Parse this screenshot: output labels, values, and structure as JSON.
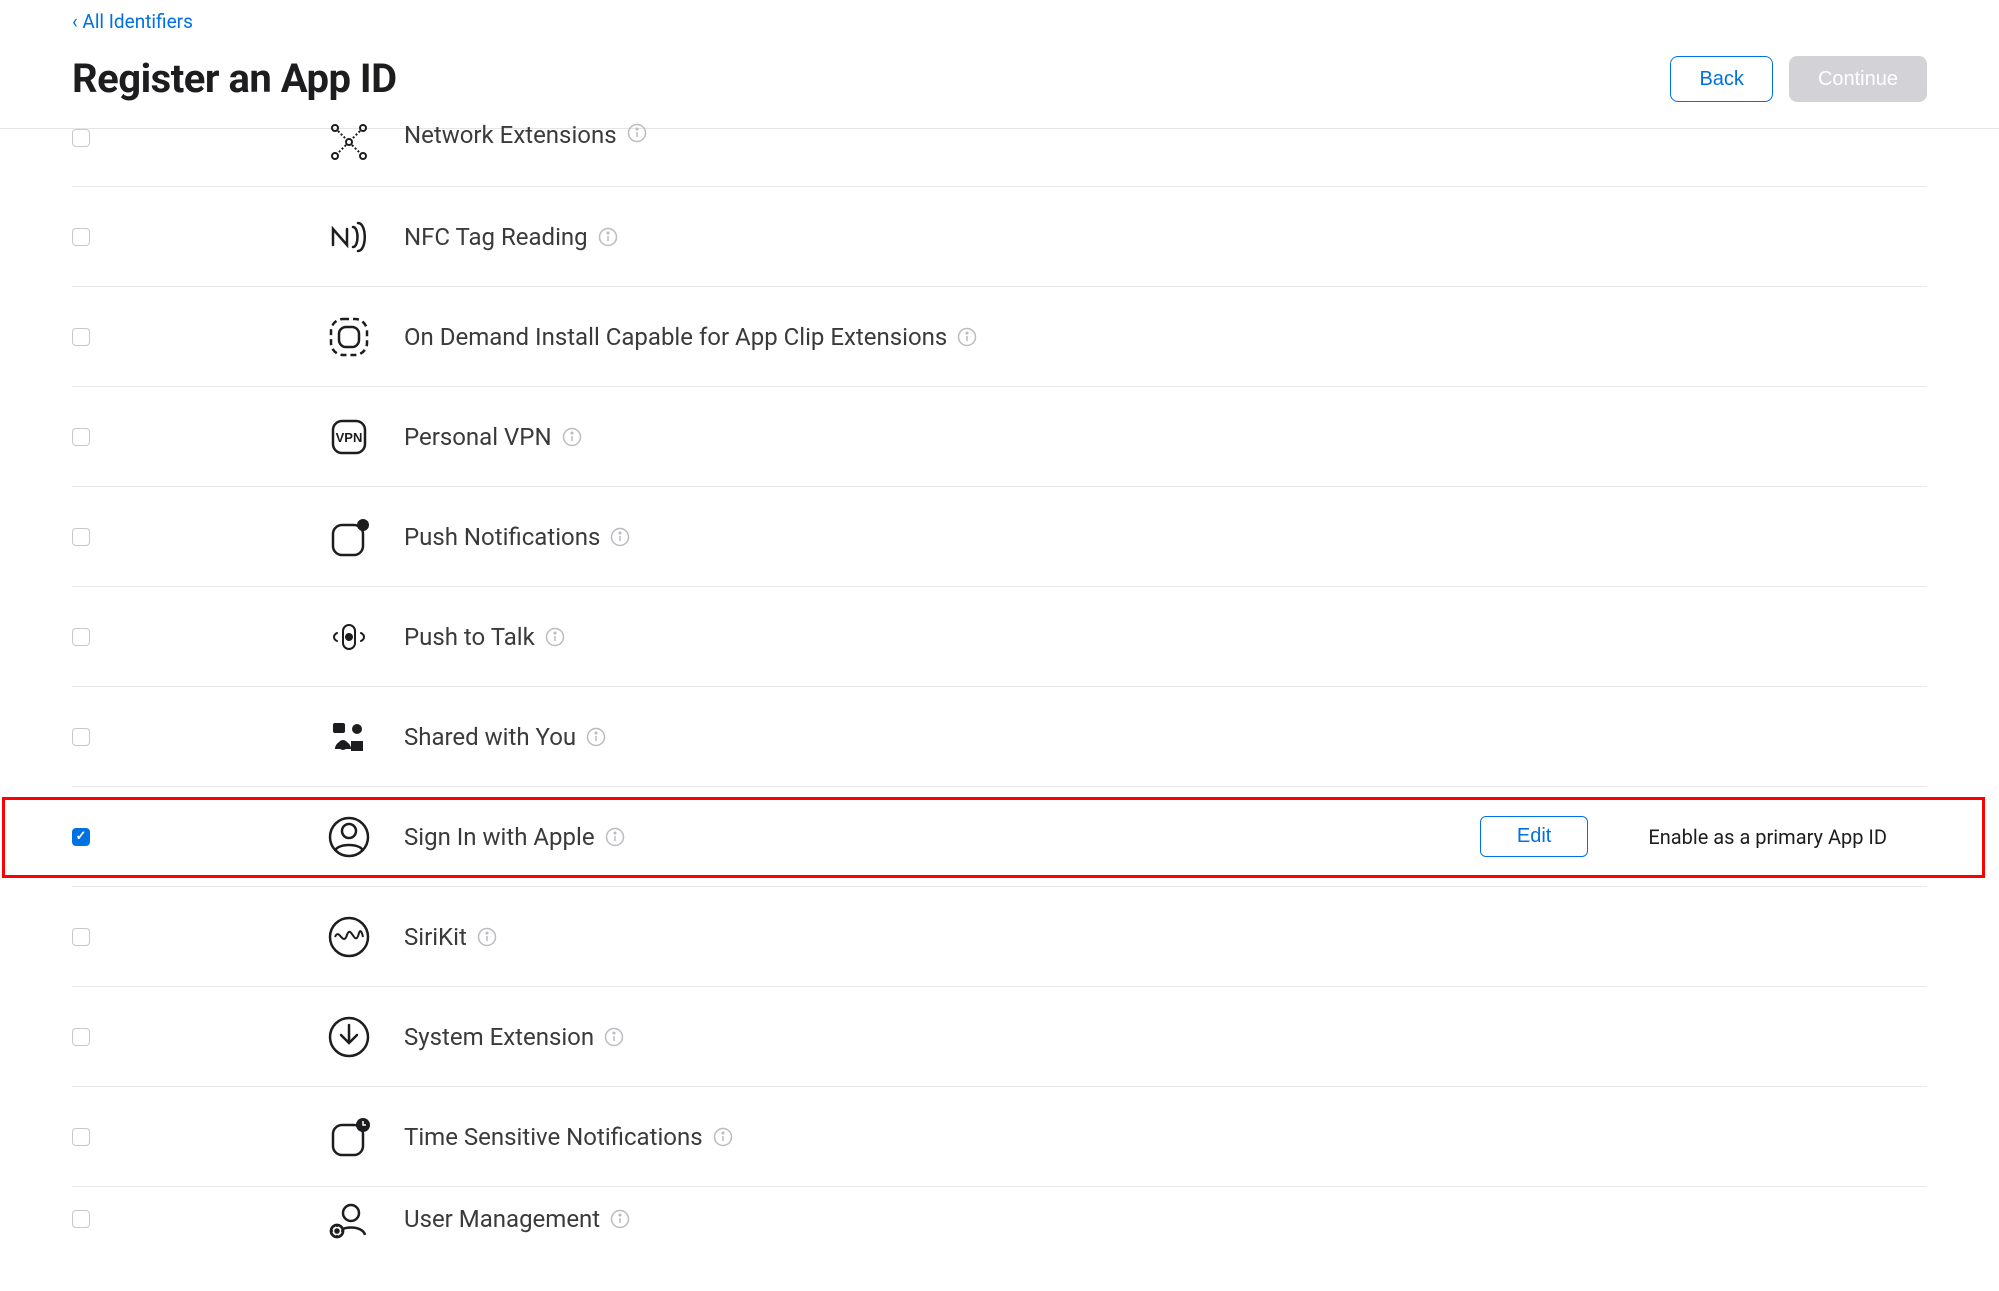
{
  "breadcrumb": {
    "label": "All Identifiers",
    "prefix": "‹ "
  },
  "header": {
    "title": "Register an App ID",
    "back_label": "Back",
    "continue_label": "Continue"
  },
  "capabilities": [
    {
      "id": "network-extensions",
      "label": "Network Extensions",
      "checked": false,
      "icon": "network-extensions-icon"
    },
    {
      "id": "nfc-tag-reading",
      "label": "NFC Tag Reading",
      "checked": false,
      "icon": "nfc-icon"
    },
    {
      "id": "on-demand-install",
      "label": "On Demand Install Capable for App Clip Extensions",
      "checked": false,
      "icon": "app-clip-icon"
    },
    {
      "id": "personal-vpn",
      "label": "Personal VPN",
      "checked": false,
      "icon": "vpn-icon"
    },
    {
      "id": "push-notifications",
      "label": "Push Notifications",
      "checked": false,
      "icon": "push-icon"
    },
    {
      "id": "push-to-talk",
      "label": "Push to Talk",
      "checked": false,
      "icon": "push-to-talk-icon"
    },
    {
      "id": "shared-with-you",
      "label": "Shared with You",
      "checked": false,
      "icon": "shared-icon"
    },
    {
      "id": "sign-in-with-apple",
      "label": "Sign In with Apple",
      "checked": true,
      "icon": "siwa-icon",
      "edit_label": "Edit",
      "note": "Enable as a primary App ID"
    },
    {
      "id": "sirikit",
      "label": "SiriKit",
      "checked": false,
      "icon": "siri-icon"
    },
    {
      "id": "system-extension",
      "label": "System Extension",
      "checked": false,
      "icon": "system-ext-icon"
    },
    {
      "id": "time-sensitive-notifications",
      "label": "Time Sensitive Notifications",
      "checked": false,
      "icon": "time-sensitive-icon"
    },
    {
      "id": "user-management",
      "label": "User Management",
      "checked": false,
      "icon": "user-management-icon"
    }
  ]
}
